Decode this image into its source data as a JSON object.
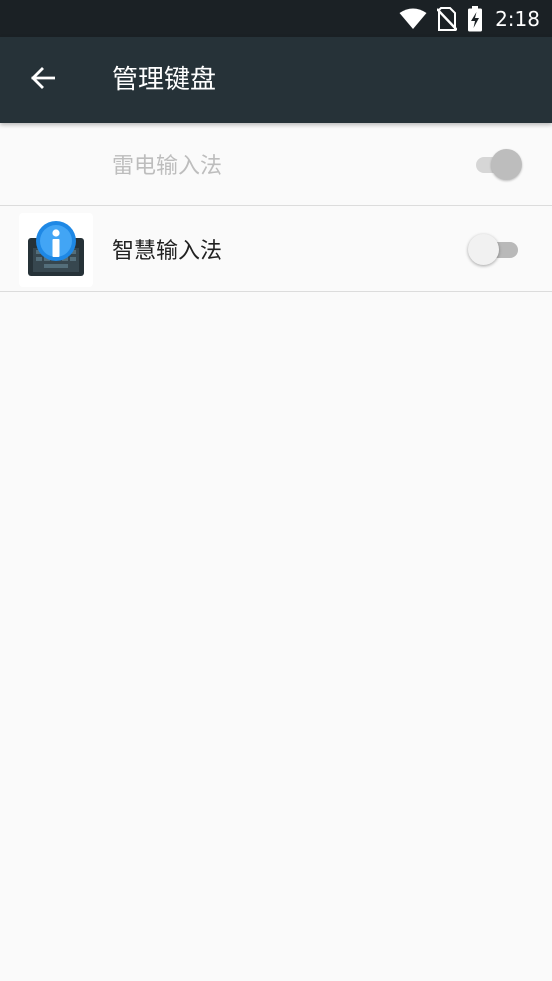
{
  "status_bar": {
    "time": "2:18",
    "icons": [
      "wifi-icon",
      "no-sim-icon",
      "battery-charging-icon"
    ]
  },
  "app_bar": {
    "back_icon": "arrow-back-icon",
    "title": "管理键盘"
  },
  "keyboards": [
    {
      "name": "雷电输入法",
      "enabled": true,
      "disabled": true,
      "icon": null
    },
    {
      "name": "智慧输入法",
      "enabled": false,
      "disabled": false,
      "icon": "keyboard-app-icon"
    }
  ],
  "colors": {
    "status_bar": "#1b2125",
    "app_bar": "#263238",
    "background": "#fafafa",
    "icon_blue": "#1e88e5",
    "icon_dark": "#263238"
  }
}
